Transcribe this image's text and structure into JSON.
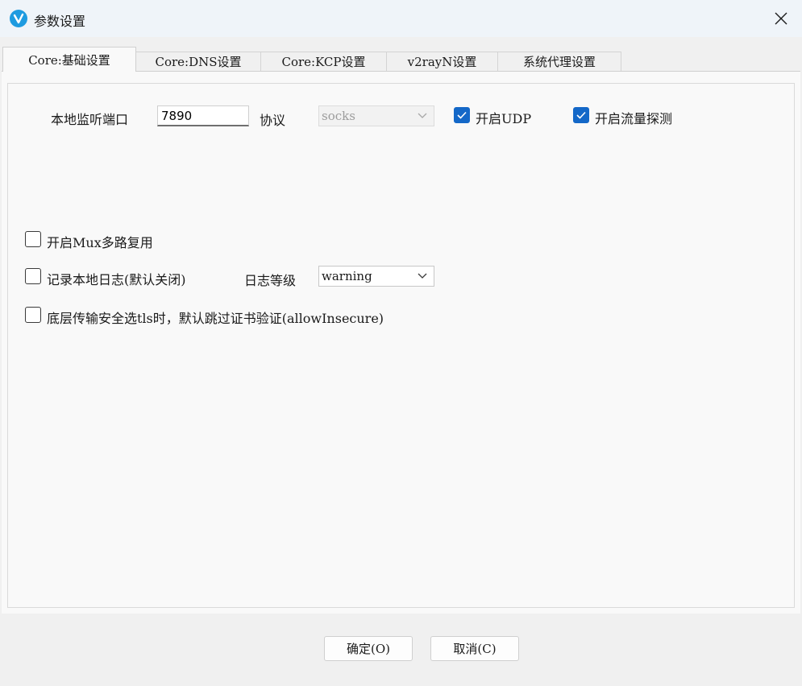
{
  "window": {
    "title": "参数设置",
    "close_symbol": "✕"
  },
  "tabs": [
    {
      "label": "Core:基础设置",
      "active": true
    },
    {
      "label": "Core:DNS设置"
    },
    {
      "label": "Core:KCP设置"
    },
    {
      "label": "v2rayN设置"
    },
    {
      "label": "系统代理设置"
    }
  ],
  "basic": {
    "local_port_label": "本地监听端口",
    "local_port_value": "7890",
    "protocol_label": "协议",
    "protocol_value": "socks",
    "enable_udp_label": "开启UDP",
    "enable_udp_checked": true,
    "enable_sniffing_label": "开启流量探测",
    "enable_sniffing_checked": true,
    "mux_label": "开启Mux多路复用",
    "mux_checked": false,
    "log_label": "记录本地日志(默认关闭)",
    "log_checked": false,
    "log_level_label": "日志等级",
    "log_level_value": "warning",
    "allow_insecure_label": "底层传输安全选tls时，默认跳过证书验证(allowInsecure)",
    "allow_insecure_checked": false
  },
  "buttons": {
    "ok": "确定(O)",
    "cancel": "取消(C)"
  },
  "colors": {
    "accent": "#1468c8",
    "app_icon": "#1e9be0"
  }
}
